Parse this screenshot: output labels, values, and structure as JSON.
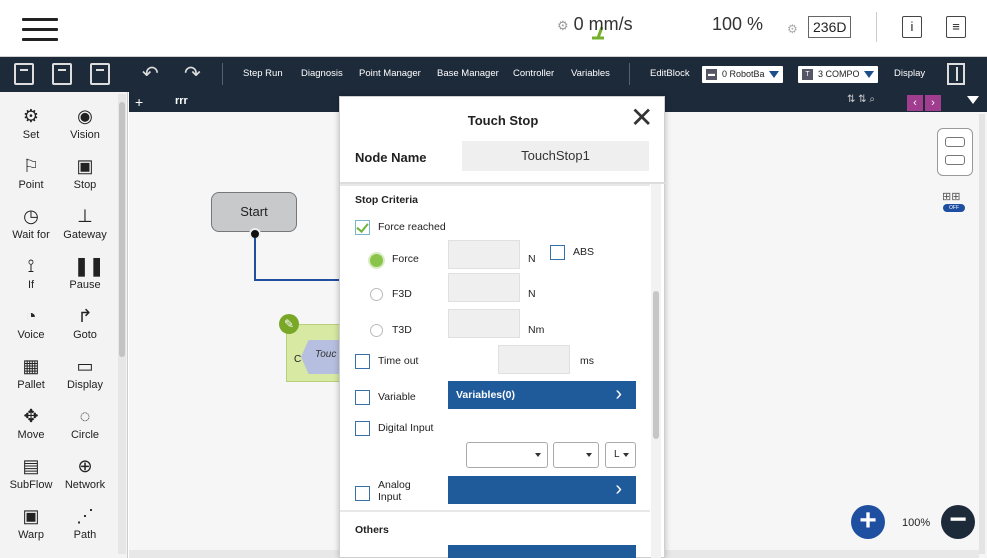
{
  "topbar": {
    "speed_value": "0 mm/s",
    "percent": "100 %",
    "counter": "236D",
    "info": "i"
  },
  "toolbar": {
    "items": [
      "Step Run",
      "Diagnosis",
      "Point Manager",
      "Base Manager",
      "Controller",
      "Variables"
    ],
    "edit_block": "EditBlock",
    "robot_select": "0 RobotBa",
    "compo_select": "3 COMPO",
    "display": "Display"
  },
  "palette": {
    "items": [
      {
        "label": "Set",
        "icon": "settings-icon"
      },
      {
        "label": "Vision",
        "icon": "eye-icon"
      },
      {
        "label": "Point",
        "icon": "point-icon"
      },
      {
        "label": "Stop",
        "icon": "stop-icon"
      },
      {
        "label": "Wait for",
        "icon": "clock-icon"
      },
      {
        "label": "Gateway",
        "icon": "gateway-icon"
      },
      {
        "label": "If",
        "icon": "if-icon"
      },
      {
        "label": "Pause",
        "icon": "pause-icon"
      },
      {
        "label": "Voice",
        "icon": "voice-icon"
      },
      {
        "label": "Goto",
        "icon": "goto-icon"
      },
      {
        "label": "Pallet",
        "icon": "pallet-icon"
      },
      {
        "label": "Display",
        "icon": "display-icon"
      },
      {
        "label": "Move",
        "icon": "move-icon"
      },
      {
        "label": "Circle",
        "icon": "circle-icon"
      },
      {
        "label": "SubFlow",
        "icon": "subflow-icon"
      },
      {
        "label": "Network",
        "icon": "network-icon"
      },
      {
        "label": "Warp",
        "icon": "warp-icon"
      },
      {
        "label": "Path",
        "icon": "path-icon"
      }
    ]
  },
  "canvas": {
    "tab_name": "rrr",
    "start_label": "Start",
    "touch_label": "Touc",
    "touch_prefix": "C",
    "zoom": "100%"
  },
  "modal": {
    "title": "Touch Stop",
    "node_name_label": "Node Name",
    "node_name_value": "TouchStop1",
    "stop_criteria_label": "Stop Criteria",
    "force_reached_label": "Force reached",
    "force_label": "Force",
    "force_unit": "N",
    "abs_label": "ABS",
    "f3d_label": "F3D",
    "f3d_unit": "N",
    "t3d_label": "T3D",
    "t3d_unit": "Nm",
    "timeout_label": "Time out",
    "timeout_unit": "ms",
    "variable_label": "Variable",
    "variables_button": "Variables(0)",
    "digital_input_label": "Digital Input",
    "dd3_value": "L",
    "analog_input_label": "Analog Input",
    "others_label": "Others"
  },
  "colors": {
    "toolbar_bg": "#1d2a3a",
    "accent_blue": "#1f5a9a",
    "radio_green": "#8ac44a"
  }
}
